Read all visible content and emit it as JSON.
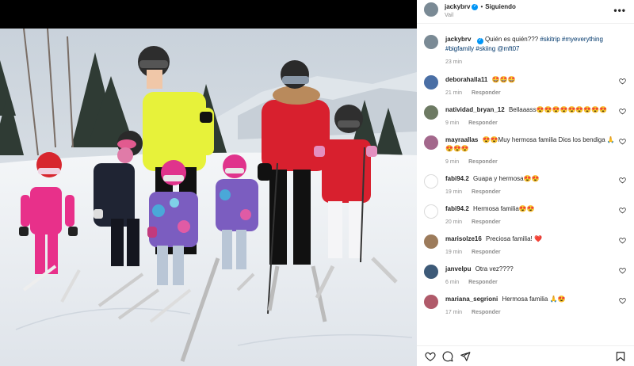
{
  "post": {
    "author": "jackybrv",
    "follow_label": "Siguiendo",
    "location": "Vail",
    "caption": {
      "text": "Quién es quién??? ",
      "tags": "#skitrip #myeverything #bigfamily #skiing @mft07"
    },
    "time": "23 min"
  },
  "reply_label": "Responder",
  "comments": [
    {
      "user": "deborahalla11",
      "text": "🤩🤩🤩",
      "time": "21 min",
      "avatar_color": "#4a6fa5"
    },
    {
      "user": "natividad_bryan_12",
      "text": "Bellaaass😍😍😍😍😍😍😍😍😍",
      "time": "9 min",
      "avatar_color": "#6d7a63"
    },
    {
      "user": "mayraallas",
      "text": "😍😍Muy hermosa familia Dios los bendiga 🙏😍😍😍",
      "time": "9 min",
      "avatar_color": "#a3688c"
    },
    {
      "user": "fabi94.2",
      "text": "Guapa y hermosa😍😍",
      "time": "19 min",
      "avatar_color": "#ffffff"
    },
    {
      "user": "fabi94.2",
      "text": "Hermosa familia😍😍",
      "time": "20 min",
      "avatar_color": "#ffffff"
    },
    {
      "user": "marisolze16",
      "text": "Preciosa familia! ❤️",
      "time": "19 min",
      "avatar_color": "#9c7b5b"
    },
    {
      "user": "janvelpu",
      "text": "Otra vez????",
      "time": "6 min",
      "avatar_color": "#3d5a78"
    },
    {
      "user": "mariana_segrioni",
      "text": "Hermosa familia 🙏😍",
      "time": "17 min",
      "avatar_color": "#b05a6a"
    }
  ],
  "icons": {
    "like": "heart-icon",
    "comment": "comment-icon",
    "share": "share-icon",
    "save": "bookmark-icon"
  },
  "colors": {
    "verified": "#0095f6",
    "muted": "#8e8e8e",
    "tag": "#00376b"
  }
}
